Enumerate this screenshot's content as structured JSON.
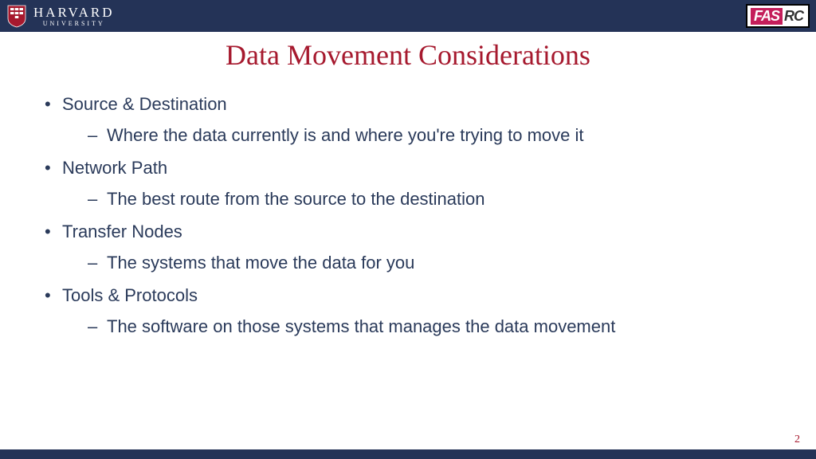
{
  "header": {
    "logo_name": "HARVARD",
    "logo_sub": "UNIVERSITY",
    "badge_fas": "FAS",
    "badge_rc": "RC"
  },
  "slide": {
    "title": "Data Movement Considerations",
    "bullets": [
      {
        "text": "Source & Destination",
        "sub": "Where the data currently is and where you're trying to move it"
      },
      {
        "text": "Network Path",
        "sub": "The best route from the source to the destination"
      },
      {
        "text": "Transfer Nodes",
        "sub": "The systems that move the data for you"
      },
      {
        "text": "Tools & Protocols",
        "sub": "The software on those systems that manages the data movement"
      }
    ],
    "page_number": "2"
  }
}
